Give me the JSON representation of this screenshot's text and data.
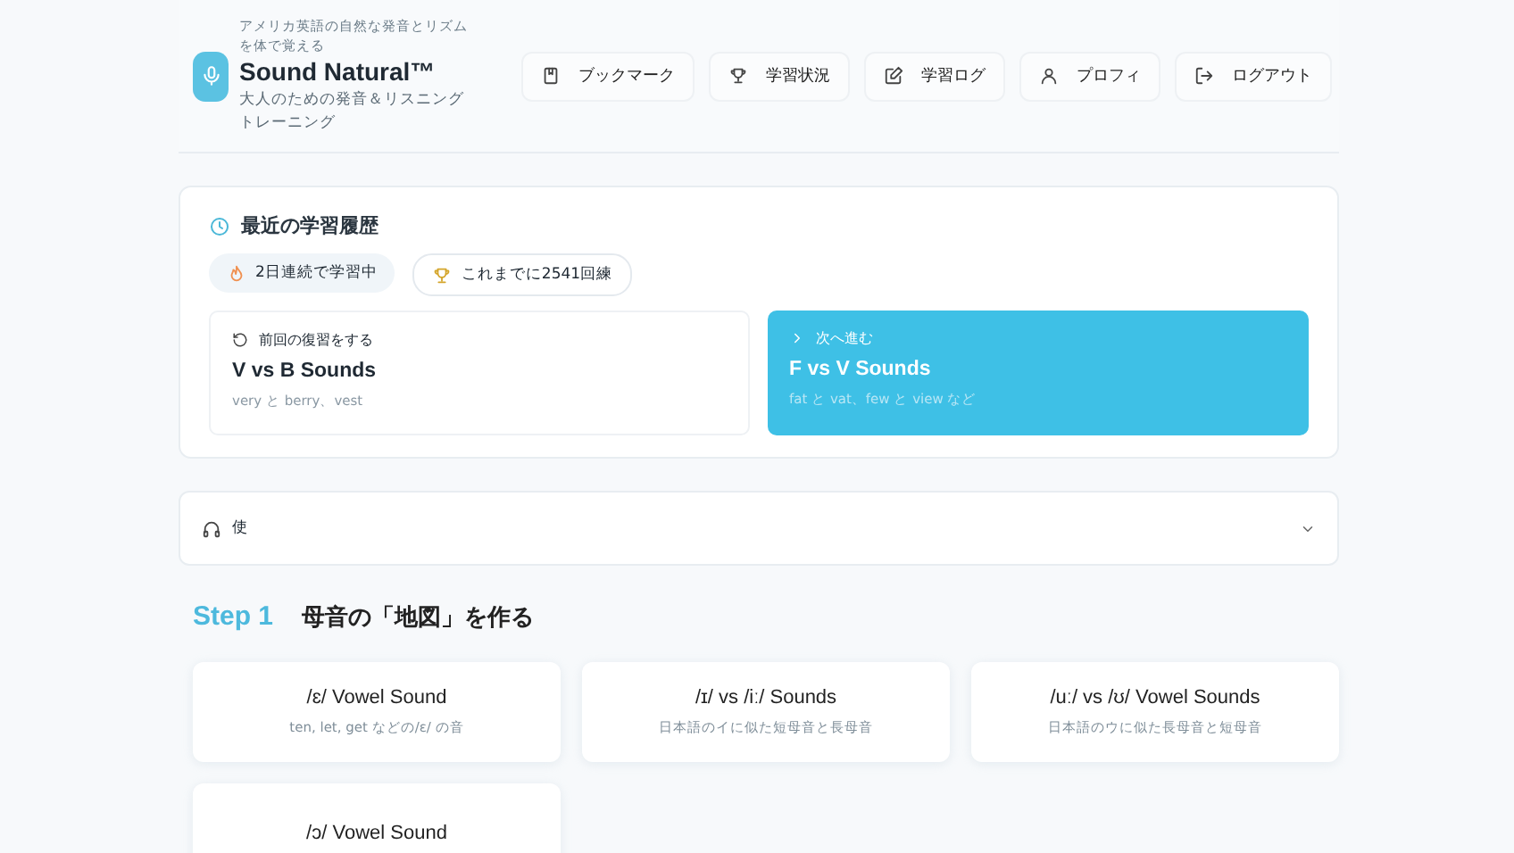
{
  "header": {
    "tagline": "アメリカ英語の自然な発音とリズムを体で覚える",
    "title": "Sound Natural™",
    "subtitle": "大人のための発音＆リスニングトレーニング",
    "nav": [
      {
        "label": "ブックマーク",
        "kind": "bookmark"
      },
      {
        "label": "学習状況",
        "kind": "trophy"
      },
      {
        "label": "学習ログ",
        "kind": "edit"
      },
      {
        "label": "プロフィ",
        "kind": "user"
      },
      {
        "label": "ログアウト",
        "kind": "logout"
      }
    ]
  },
  "history": {
    "title": "最近の学習履歴",
    "badges": [
      {
        "label": "2日連続で学習中",
        "kind": "streak"
      },
      {
        "label": "これまでに2541回練",
        "kind": "total"
      }
    ],
    "cards": [
      {
        "kind": "review",
        "action": "前回の復習をする",
        "title": "V vs B Sounds",
        "desc": "very と berry、vest"
      },
      {
        "kind": "next",
        "action": "次へ進む",
        "title": "F vs V Sounds",
        "desc": "fat と vat、few と view など"
      }
    ]
  },
  "accordion": {
    "label": "使",
    "expanded": false
  },
  "step": {
    "number": "Step 1",
    "title": "母音の「地図」を作る",
    "lessons": [
      {
        "title": "/ɛ/ Vowel Sound",
        "desc": "ten, let, get などの/ɛ/ の音"
      },
      {
        "title": "/ɪ/ vs /iː/ Sounds",
        "desc": "日本語のイに似た短母音と長母音"
      },
      {
        "title": "/uː/ vs /ʊ/ Vowel Sounds",
        "desc": "日本語のウに似た長母音と短母音"
      },
      {
        "title": "/ɔ/ Vowel Sound"
      }
    ]
  }
}
